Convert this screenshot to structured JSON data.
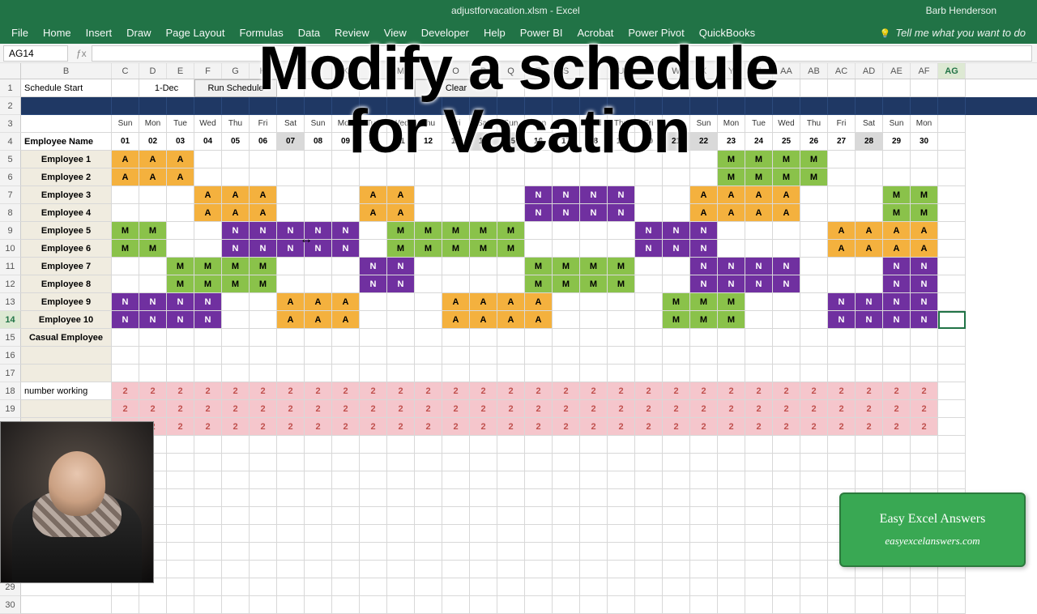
{
  "titlebar": {
    "doc": "adjustforvacation.xlsm - Excel",
    "user": "Barb Henderson"
  },
  "ribbon": [
    "File",
    "Home",
    "Insert",
    "Draw",
    "Page Layout",
    "Formulas",
    "Data",
    "Review",
    "View",
    "Developer",
    "Help",
    "Power BI",
    "Acrobat",
    "Power Pivot",
    "QuickBooks"
  ],
  "tell_me": "Tell me what you want to do",
  "name_box": "AG14",
  "overlay": {
    "line1": "Modify a schedule",
    "line2": "for Vacation"
  },
  "colLetters": [
    "B",
    "C",
    "D",
    "E",
    "F",
    "G",
    "H",
    "I",
    "J",
    "K",
    "L",
    "M",
    "N",
    "O",
    "P",
    "Q",
    "R",
    "S",
    "T",
    "U",
    "V",
    "W",
    "X",
    "Y",
    "Z",
    "AA",
    "AB",
    "AC",
    "AD",
    "AE",
    "AF",
    "AG"
  ],
  "selectedCol": 31,
  "row1": {
    "schedStart": "Schedule Start",
    "date": "1-Dec",
    "btnRun": "Run Schedule",
    "btnClear": "Clear"
  },
  "days": [
    "Sun",
    "Mon",
    "Tue",
    "Wed",
    "Thu",
    "Fri",
    "Sat",
    "Sun",
    "Mon",
    "Tue",
    "Wed",
    "Thu",
    "Fri",
    "Sat",
    "Sun",
    "Mon",
    "Tue",
    "Wed",
    "Thu",
    "Fri",
    "Sat",
    "Sun",
    "Mon",
    "Tue",
    "Wed",
    "Thu",
    "Fri",
    "Sat",
    "Sun",
    "Mon"
  ],
  "dates": [
    "01",
    "02",
    "03",
    "04",
    "05",
    "06",
    "07",
    "08",
    "09",
    "10",
    "11",
    "12",
    "13",
    "14",
    "15",
    "16",
    "17",
    "18",
    "19",
    "20",
    "21",
    "22",
    "23",
    "24",
    "25",
    "26",
    "27",
    "28",
    "29",
    "30"
  ],
  "grayDateIdx": [
    6,
    13,
    14,
    20,
    21,
    27
  ],
  "labels": {
    "empName": "Employee Name",
    "casual": "Casual Employee",
    "numWorking": "number working"
  },
  "employees": [
    "Employee 1",
    "Employee 2",
    "Employee 3",
    "Employee 4",
    "Employee 5",
    "Employee 6",
    "Employee 7",
    "Employee 8",
    "Employee 9",
    "Employee 10"
  ],
  "schedule": [
    [
      "A",
      "A",
      "A",
      "",
      "",
      "",
      "",
      "",
      "",
      "",
      "",
      "",
      "",
      "",
      "",
      "",
      "",
      "",
      "",
      "",
      "",
      "",
      "M",
      "M",
      "M",
      "M",
      "",
      "",
      "",
      ""
    ],
    [
      "A",
      "A",
      "A",
      "",
      "",
      "",
      "",
      "",
      "",
      "",
      "",
      "",
      "",
      "",
      "",
      "",
      "",
      "",
      "",
      "",
      "",
      "",
      "M",
      "M",
      "M",
      "M",
      "",
      "",
      "",
      ""
    ],
    [
      "",
      "",
      "",
      "A",
      "A",
      "A",
      "",
      "",
      "",
      "A",
      "A",
      "",
      "",
      "",
      "",
      "N",
      "N",
      "N",
      "N",
      "",
      "",
      "A",
      "A",
      "A",
      "A",
      "",
      "",
      "",
      "M",
      "M"
    ],
    [
      "",
      "",
      "",
      "A",
      "A",
      "A",
      "",
      "",
      "",
      "A",
      "A",
      "",
      "",
      "",
      "",
      "N",
      "N",
      "N",
      "N",
      "",
      "",
      "A",
      "A",
      "A",
      "A",
      "",
      "",
      "",
      "M",
      "M"
    ],
    [
      "M",
      "M",
      "",
      "",
      "N",
      "N",
      "N",
      "N",
      "N",
      "",
      "M",
      "M",
      "M",
      "M",
      "M",
      "",
      "",
      "",
      "",
      "N",
      "N",
      "N",
      "",
      "",
      "",
      "",
      "A",
      "A",
      "A",
      "A"
    ],
    [
      "M",
      "M",
      "",
      "",
      "N",
      "N",
      "N",
      "N",
      "N",
      "",
      "M",
      "M",
      "M",
      "M",
      "M",
      "",
      "",
      "",
      "",
      "N",
      "N",
      "N",
      "",
      "",
      "",
      "",
      "A",
      "A",
      "A",
      "A"
    ],
    [
      "",
      "",
      "M",
      "M",
      "M",
      "M",
      "",
      "",
      "",
      "N",
      "N",
      "",
      "",
      "",
      "",
      "M",
      "M",
      "M",
      "M",
      "",
      "",
      "N",
      "N",
      "N",
      "N",
      "",
      "",
      "",
      "N",
      "N"
    ],
    [
      "",
      "",
      "M",
      "M",
      "M",
      "M",
      "",
      "",
      "",
      "N",
      "N",
      "",
      "",
      "",
      "",
      "M",
      "M",
      "M",
      "M",
      "",
      "",
      "N",
      "N",
      "N",
      "N",
      "",
      "",
      "",
      "N",
      "N"
    ],
    [
      "N",
      "N",
      "N",
      "N",
      "",
      "",
      "A",
      "A",
      "A",
      "",
      "",
      "",
      "A",
      "A",
      "A",
      "A",
      "",
      "",
      "",
      "",
      "M",
      "M",
      "M",
      "",
      "",
      "",
      "N",
      "N",
      "N",
      "N"
    ],
    [
      "N",
      "N",
      "N",
      "N",
      "",
      "",
      "A",
      "A",
      "A",
      "",
      "",
      "",
      "A",
      "A",
      "A",
      "A",
      "",
      "",
      "",
      "",
      "M",
      "M",
      "M",
      "",
      "",
      "",
      "N",
      "N",
      "N",
      "N"
    ]
  ],
  "summaryVal": "2",
  "promo": {
    "title": "Easy Excel Answers",
    "site": "easyexcelanswers.com"
  }
}
